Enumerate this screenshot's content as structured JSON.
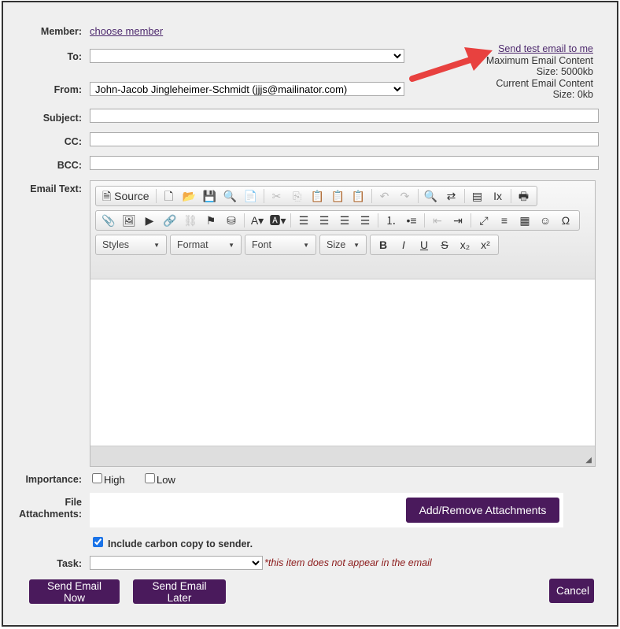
{
  "member": {
    "label": "Member:",
    "link": "choose member"
  },
  "to": {
    "label": "To:",
    "value": ""
  },
  "from": {
    "label": "From:",
    "value": "John-Jacob Jingleheimer-Schmidt (jjjs@mailinator.com)"
  },
  "info": {
    "test_link": "Send test email to me",
    "max_line1": "Maximum Email Content",
    "max_line2": "Size: 5000kb",
    "cur_line1": "Current Email Content",
    "cur_line2": "Size: 0kb"
  },
  "subject": {
    "label": "Subject:",
    "value": ""
  },
  "cc": {
    "label": "CC:",
    "value": ""
  },
  "bcc": {
    "label": "BCC:",
    "value": ""
  },
  "email_text": {
    "label": "Email Text:"
  },
  "toolbar": {
    "source_label": "Source",
    "row1": [
      "new-page",
      "open",
      "save",
      "preview",
      "templates",
      "|",
      "cut",
      "copy",
      "paste",
      "paste-text",
      "paste-word",
      "|",
      "undo",
      "redo",
      "|",
      "find",
      "replace",
      "|",
      "select-all",
      "remove-format",
      "|",
      "print"
    ],
    "row2": [
      "attachment",
      "image",
      "youtube",
      "link",
      "unlink",
      "anchor",
      "flash",
      "|",
      "text-color",
      "bg-color",
      "|",
      "align-left",
      "align-center",
      "align-right",
      "justify",
      "|",
      "numbered-list",
      "bulleted-list",
      "|",
      "outdent",
      "indent",
      "|",
      "maximize",
      "horizontal-rule",
      "table",
      "smiley",
      "special-char"
    ],
    "combos": [
      "Styles",
      "Format",
      "Font",
      "Size"
    ],
    "row3": [
      "bold",
      "italic",
      "underline",
      "strike",
      "subscript",
      "superscript"
    ]
  },
  "importance": {
    "label": "Importance:",
    "high": "High",
    "low": "Low",
    "high_checked": false,
    "low_checked": false
  },
  "attachments": {
    "label1": "File",
    "label2": "Attachments:",
    "button": "Add/Remove Attachments"
  },
  "carbon_copy": {
    "label": "Include carbon copy to sender.",
    "checked": true
  },
  "task": {
    "label": "Task:",
    "value": "",
    "note": "*this item does not appear in the email"
  },
  "buttons": {
    "send_now": "Send Email Now",
    "send_later": "Send Email Later",
    "cancel": "Cancel"
  },
  "colors": {
    "accent": "#4a1a5c",
    "arrow": "#e8413f",
    "note": "#8b1a1a"
  }
}
